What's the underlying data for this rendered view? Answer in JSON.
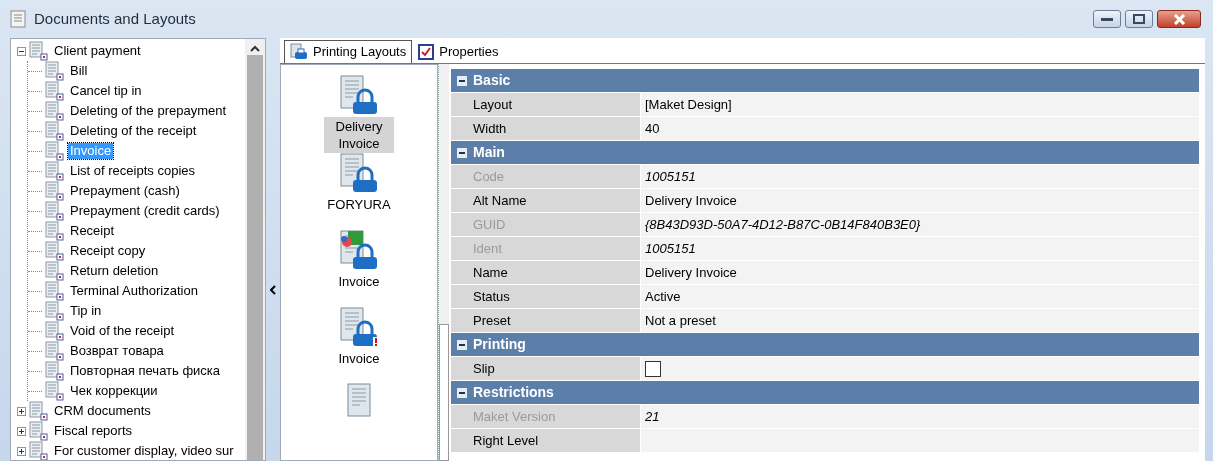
{
  "window": {
    "title": "Documents and Layouts"
  },
  "tree": [
    {
      "label": "Client payment",
      "expanded": true,
      "selected": false,
      "children": [
        {
          "label": "Bill",
          "selected": false
        },
        {
          "label": "Cancel tip in",
          "selected": false
        },
        {
          "label": "Deleting of the prepayment",
          "selected": false
        },
        {
          "label": "Deleting of the receipt",
          "selected": false
        },
        {
          "label": "Invoice",
          "selected": true
        },
        {
          "label": "List of receipts copies",
          "selected": false
        },
        {
          "label": "Prepayment (cash)",
          "selected": false
        },
        {
          "label": "Prepayment (credit cards)",
          "selected": false
        },
        {
          "label": "Receipt",
          "selected": false
        },
        {
          "label": "Receipt copy",
          "selected": false
        },
        {
          "label": "Return deletion",
          "selected": false
        },
        {
          "label": "Terminal Authorization",
          "selected": false
        },
        {
          "label": "Tip in",
          "selected": false
        },
        {
          "label": "Void of the receipt",
          "selected": false
        },
        {
          "label": "Возврат товара",
          "selected": false
        },
        {
          "label": "Повторная печать фиска",
          "selected": false
        },
        {
          "label": "Чек коррекции",
          "selected": false
        }
      ]
    },
    {
      "label": "CRM documents",
      "expanded": false,
      "selected": false
    },
    {
      "label": "Fiscal reports",
      "expanded": false,
      "selected": false
    },
    {
      "label": "For customer display, video sur",
      "expanded": false,
      "selected": false
    }
  ],
  "tabs": [
    {
      "label": "Printing Layouts",
      "selected": true,
      "kind": "printer"
    },
    {
      "label": "Properties",
      "selected": false,
      "kind": "checklist"
    }
  ],
  "layouts": [
    {
      "label": "Delivery Invoice",
      "kind": "printer",
      "selected": true
    },
    {
      "label": "FORYURA",
      "kind": "printer",
      "selected": false
    },
    {
      "label": "Invoice",
      "kind": "chart",
      "selected": false
    },
    {
      "label": "Invoice",
      "kind": "alert",
      "selected": false
    },
    {
      "kind": "plain"
    }
  ],
  "properties": [
    {
      "category": "Basic",
      "expanded": true,
      "rows": [
        {
          "label": "Layout",
          "value": "[Maket Design]",
          "kind": "text",
          "disabled": false
        },
        {
          "label": "Width",
          "value": "40",
          "kind": "text",
          "disabled": false
        }
      ]
    },
    {
      "category": "Main",
      "expanded": true,
      "rows": [
        {
          "label": "Code",
          "value": "1005151",
          "kind": "text",
          "disabled": true
        },
        {
          "label": "Alt Name",
          "value": "Delivery Invoice",
          "kind": "text",
          "disabled": false
        },
        {
          "label": "GUID",
          "value": "{8B43D93D-50A7-4D12-B87C-0B14F840B3E0}",
          "kind": "text",
          "disabled": true
        },
        {
          "label": "Ident",
          "value": "1005151",
          "kind": "text",
          "disabled": true
        },
        {
          "label": "Name",
          "value": "Delivery Invoice",
          "kind": "text",
          "disabled": false
        },
        {
          "label": "Status",
          "value": "Active",
          "kind": "text",
          "disabled": false
        },
        {
          "label": "Preset",
          "value": "Not a preset",
          "kind": "text",
          "disabled": false
        }
      ]
    },
    {
      "category": "Printing",
      "expanded": true,
      "rows": [
        {
          "label": "Slip",
          "kind": "checkbox",
          "checked": false,
          "disabled": false
        }
      ]
    },
    {
      "category": "Restrictions",
      "expanded": true,
      "rows": [
        {
          "label": "Maket Version",
          "value": "21",
          "kind": "text",
          "disabled": true
        },
        {
          "label": "Right Level",
          "kind": "text",
          "disabled": false
        }
      ]
    }
  ]
}
